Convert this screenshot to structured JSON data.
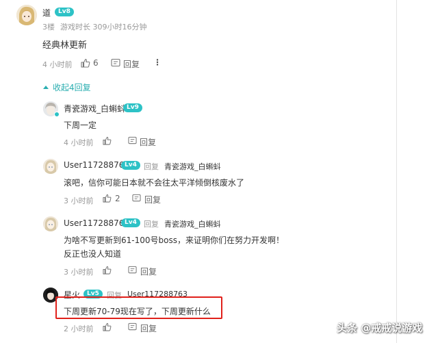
{
  "main_comment": {
    "username": "道",
    "level": "Lv8",
    "floor": "3楼",
    "playtime": "游戏时长 309小时16分钟",
    "text": "经典林更新",
    "time": "4 小时前",
    "likes": "6",
    "reply_label": "回复",
    "more_glyph": "⋮"
  },
  "collapse_label": "收起4回复",
  "replies": [
    {
      "username": "青瓷游戏_白蝌蚪",
      "level": "Lv9",
      "text": "下周一定",
      "time": "4 小时前",
      "likes": "",
      "reply_label": "回复"
    },
    {
      "username": "User117288763",
      "level": "Lv4",
      "reply_to_label": "回复",
      "reply_to_name": "青瓷游戏_白蝌蚪",
      "text": "滚吧，信你可能日本就不会往太平洋倾倒核废水了",
      "time": "3 小时前",
      "likes": "2",
      "reply_label": "回复"
    },
    {
      "username": "User117288763",
      "level": "Lv4",
      "reply_to_label": "回复",
      "reply_to_name": "青瓷游戏_白蝌蚪",
      "text_line1": "为啥不写更新到61-100号boss，来证明你们在努力开发啊！",
      "text_line2": "反正也没人知道",
      "time": "3 小时前",
      "likes": "",
      "reply_label": "回复"
    },
    {
      "username": "星火",
      "level": "Lv5",
      "reply_to_label": "回复",
      "reply_to_name": "User117288763",
      "text": "下周更新70-79现在写了，下周更新什么",
      "time": "2 小时前",
      "likes": "",
      "reply_label": "回复"
    }
  ],
  "watermark": "头条 @戒戒说游戏",
  "colors": {
    "accent": "#2aaeb0",
    "level_badge": "#2dc2c6",
    "highlight": "#e0201a"
  }
}
